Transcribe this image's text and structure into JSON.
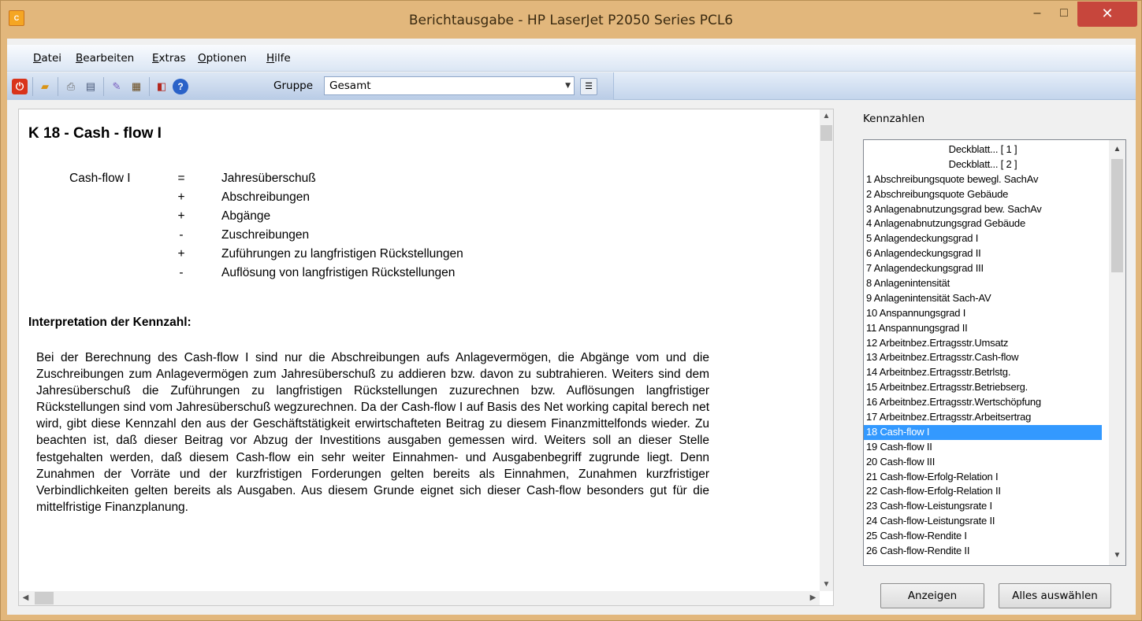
{
  "window": {
    "title": "Berichtausgabe - HP LaserJet P2050 Series PCL6",
    "app_icon_text": "C",
    "min_glyph": "–",
    "max_glyph": "□",
    "close_glyph": "✕"
  },
  "menu": {
    "items": [
      "Datei",
      "Bearbeiten",
      "Extras",
      "Optionen",
      "Hilfe"
    ]
  },
  "toolbar": {
    "gruppe_label": "Gruppe",
    "gruppe_value": "Gesamt",
    "icons": [
      "power-icon",
      "open-folder-icon",
      "print-icon",
      "print-preview-icon",
      "edit-icon",
      "export-icon",
      "pdf-icon",
      "help-icon",
      "properties-icon"
    ],
    "colors": {
      "power": "#d9331a",
      "folder": "#f2b62b",
      "help": "#2a62c8"
    }
  },
  "report": {
    "title": "K 18 - Cash - flow I",
    "formula_left": "Cash-flow I",
    "formula": [
      {
        "op": "=",
        "term": "Jahresüberschuß"
      },
      {
        "op": "+",
        "term": "Abschreibungen"
      },
      {
        "op": "+",
        "term": "Abgänge"
      },
      {
        "op": "-",
        "term": "Zuschreibungen"
      },
      {
        "op": "+",
        "term": "Zuführungen zu langfristigen Rückstellungen"
      },
      {
        "op": "-",
        "term": "Auflösung von langfristigen Rückstellungen"
      }
    ],
    "interpretation_heading": "Interpretation der Kennzahl:",
    "interpretation_text": "Bei der Berechnung des Cash-flow I sind nur die Abschreibungen aufs Anlagevermögen, die Abgänge vom und die Zuschreibungen zum Anlagevermögen zum Jahresüberschuß zu addieren bzw. davon zu subtrahieren. Weiters sind dem Jahresüberschuß die Zuführungen zu langfristigen Rückstellungen zuzurechnen bzw. Auflösungen langfristiger Rückstellungen sind vom Jahresüberschuß wegzurechnen. Da der Cash-flow I auf Basis des Net working capital berech net wird, gibt diese Kennzahl den aus der Geschäftstätigkeit erwirtschafteten Beitrag zu diesem Finanzmittelfonds wieder. Zu beachten ist, daß dieser Beitrag vor Abzug der Investitions ausgaben gemessen wird. Weiters soll an dieser Stelle festgehalten werden, daß diesem Cash-flow ein sehr weiter Einnahmen- und Ausgabenbegriff zugrunde liegt. Denn Zunahmen der Vorräte und der kurzfristigen Forderungen gelten bereits als Einnahmen, Zunahmen kurzfristiger Verbindlichkeiten gelten bereits als Ausgaben. Aus diesem Grunde eignet sich dieser Cash-flow besonders gut für die mittelfristige Finanzplanung."
  },
  "kennzahlen": {
    "label": "Kennzahlen",
    "selected_index": 19,
    "items": [
      "Deckblatt... [ 1 ]",
      "Deckblatt... [ 2 ]",
      "1 Abschreibungsquote bewegl. SachAv",
      "2 Abschreibungsquote Gebäude",
      "3 Anlagenabnutzungsgrad bew. SachAv",
      "4 Anlagenabnutzungsgrad Gebäude",
      "5 Anlagendeckungsgrad I",
      "6 Anlagendeckungsgrad II",
      "7 Anlagendeckungsgrad III",
      "8 Anlagenintensität",
      "9 Anlagenintensität Sach-AV",
      "10 Anspannungsgrad I",
      "11 Anspannungsgrad II",
      "12 Arbeitnbez.Ertragsstr.Umsatz",
      "13 Arbeitnbez.Ertragsstr.Cash-flow",
      "14 Arbeitnbez.Ertragsstr.Betrlstg.",
      "15 Arbeitnbez.Ertragsstr.Betriebserg.",
      "16 Arbeitnbez.Ertragsstr.Wertschöpfung",
      "17 Arbeitnbez.Ertragsstr.Arbeitsertrag",
      "18 Cash-flow I",
      "19 Cash-flow II",
      "20 Cash-flow III",
      "21 Cash-flow-Erfolg-Relation I",
      "22 Cash-flow-Erfolg-Relation II",
      "23 Cash-flow-Leistungsrate I",
      "24 Cash-flow-Leistungsrate II",
      "25 Cash-flow-Rendite I",
      "26 Cash-flow-Rendite II"
    ],
    "btn_show": "Anzeigen",
    "btn_select_all": "Alles auswählen"
  }
}
